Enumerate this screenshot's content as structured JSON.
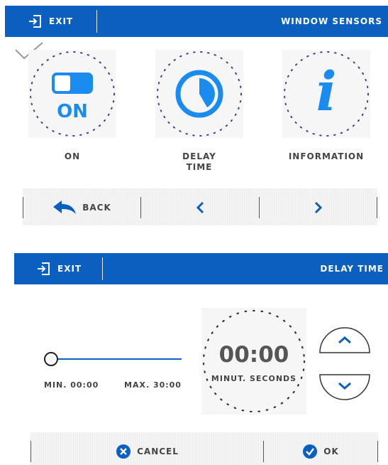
{
  "screen1": {
    "header": {
      "exit_label": "EXIT",
      "title": "WINDOW SENSORS"
    },
    "tiles": [
      {
        "name": "on",
        "badge": "ON",
        "label": "ON"
      },
      {
        "name": "delay-time",
        "label_line1": "DELAY",
        "label_line2": "TIME"
      },
      {
        "name": "information",
        "badge": "i",
        "label": "INFORMATION"
      }
    ],
    "nav": {
      "back_label": "BACK"
    }
  },
  "screen2": {
    "header": {
      "exit_label": "EXIT",
      "title": "DELAY TIME"
    },
    "slider": {
      "min_label": "MIN. 00:00",
      "max_label": "MAX. 30:00",
      "value_fraction": 0
    },
    "timer": {
      "value": "00:00",
      "minutes_label": "MINUT.",
      "seconds_label": "SECONDS"
    },
    "footer": {
      "cancel_label": "CANCEL",
      "ok_label": "OK"
    }
  },
  "colors": {
    "accent": "#0a5fbf",
    "icon_blue": "#1a8cf0",
    "ring_dots": "#3f3f8f"
  }
}
